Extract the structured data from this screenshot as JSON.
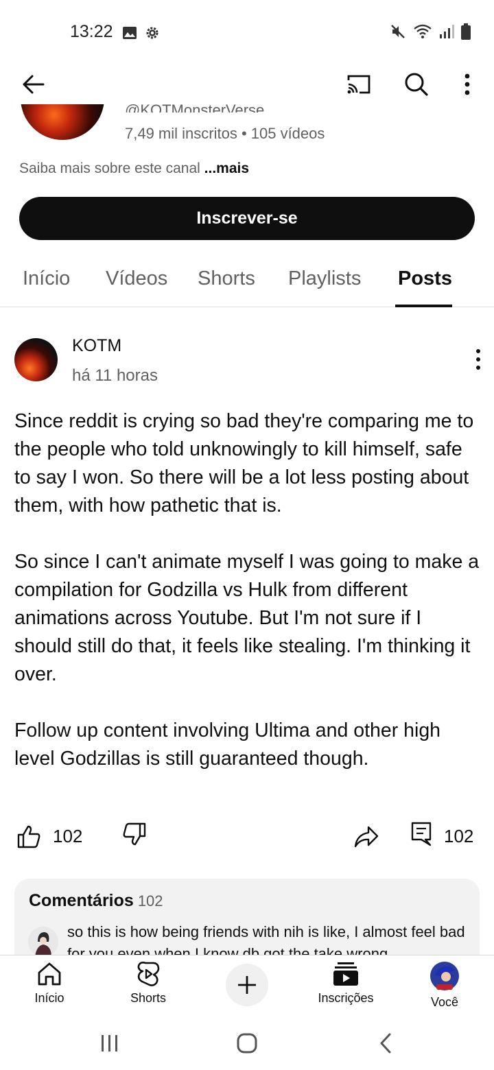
{
  "status_bar": {
    "time": "13:22"
  },
  "channel": {
    "handle": "@KOTMonsterVerse",
    "stats": "7,49 mil inscritos • 105 vídeos",
    "about": "Saiba mais sobre este canal",
    "about_more": "...mais",
    "subscribe_label": "Inscrever-se"
  },
  "tabs": [
    {
      "label": "Início"
    },
    {
      "label": "Vídeos"
    },
    {
      "label": "Shorts"
    },
    {
      "label": "Playlists"
    },
    {
      "label": "Posts",
      "active": true
    }
  ],
  "post": {
    "author": "KOTM",
    "time": "há 11 horas",
    "paragraphs": [
      "Since reddit is crying so bad they're comparing me to the people who told unknowingly to kill himself, safe to say I won. So there will be a lot less posting about them, with how pathetic that is.",
      "So since I can't animate myself I was going to make a compilation for Godzilla vs Hulk from different animations across Youtube. But I'm not sure if I should still do that, it feels like stealing. I'm thinking it over.",
      "Follow up content involving Ultima and other high level Godzillas is still guaranteed though."
    ],
    "like_count": "102",
    "comment_count": "102"
  },
  "comments": {
    "title": "Comentários",
    "count": "102",
    "preview": "so this is how being friends with nih is like, I almost feel bad for you even when I know db got the take wrong"
  },
  "bottom_nav": {
    "home": "Início",
    "shorts": "Shorts",
    "subscriptions": "Inscrições",
    "you": "Você"
  },
  "colors": {
    "text": "#0f0f0f",
    "secondary": "#606060",
    "subscribe_bg": "#0f0f0f"
  }
}
